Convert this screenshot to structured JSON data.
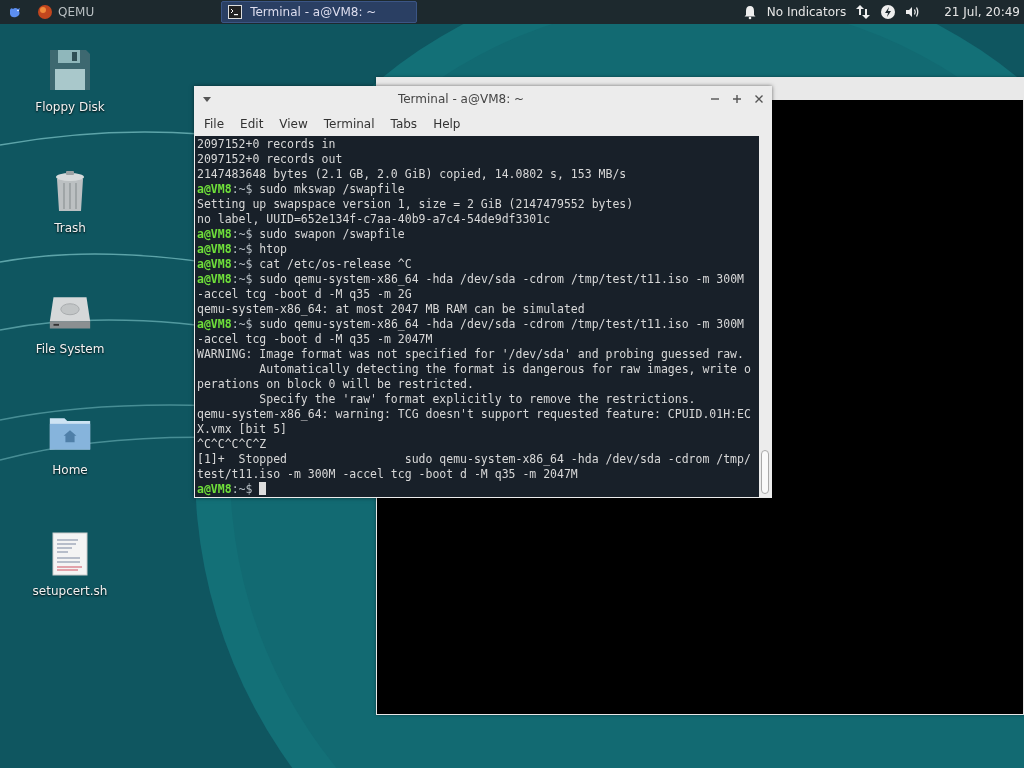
{
  "panel": {
    "app_menu": "QEMU",
    "tasks": [
      {
        "label": "Terminal - a@VM8: ~",
        "selected": true
      }
    ],
    "indicators": "No Indicators",
    "clock": "21 Jul, 20:49"
  },
  "desktop_icons": [
    {
      "kind": "floppy",
      "label": "Floppy Disk"
    },
    {
      "kind": "trash",
      "label": "Trash"
    },
    {
      "kind": "drive",
      "label": "File System"
    },
    {
      "kind": "home",
      "label": "Home"
    },
    {
      "kind": "script",
      "label": "setupcert.sh"
    }
  ],
  "terminal": {
    "title": "Terminal - a@VM8: ~",
    "menu": [
      "File",
      "Edit",
      "View",
      "Terminal",
      "Tabs",
      "Help"
    ],
    "lines": [
      {
        "kind": "output",
        "text": "2097152+0 records in"
      },
      {
        "kind": "output",
        "text": "2097152+0 records out"
      },
      {
        "kind": "output",
        "text": "2147483648 bytes (2.1 GB, 2.0 GiB) copied, 14.0802 s, 153 MB/s"
      },
      {
        "kind": "prompt",
        "user": "a@VM8",
        "suffix": ":~$",
        "command": " sudo mkswap /swapfile"
      },
      {
        "kind": "output",
        "text": "Setting up swapspace version 1, size = 2 GiB (2147479552 bytes)"
      },
      {
        "kind": "output",
        "text": "no label, UUID=652e134f-c7aa-40b9-a7c4-54de9df3301c"
      },
      {
        "kind": "prompt",
        "user": "a@VM8",
        "suffix": ":~$",
        "command": " sudo swapon /swapfile"
      },
      {
        "kind": "prompt",
        "user": "a@VM8",
        "suffix": ":~$",
        "command": " htop"
      },
      {
        "kind": "prompt",
        "user": "a@VM8",
        "suffix": ":~$",
        "command": " cat /etc/os-release ^C"
      },
      {
        "kind": "prompt",
        "user": "a@VM8",
        "suffix": ":~$",
        "command": " sudo qemu-system-x86_64 -hda /dev/sda -cdrom /tmp/test/t11.iso -m 300M"
      },
      {
        "kind": "output",
        "text": "-accel tcg -boot d -M q35 -m 2G"
      },
      {
        "kind": "output",
        "text": "qemu-system-x86_64: at most 2047 MB RAM can be simulated"
      },
      {
        "kind": "prompt",
        "user": "a@VM8",
        "suffix": ":~$",
        "command": " sudo qemu-system-x86_64 -hda /dev/sda -cdrom /tmp/test/t11.iso -m 300M"
      },
      {
        "kind": "output",
        "text": "-accel tcg -boot d -M q35 -m 2047M"
      },
      {
        "kind": "output",
        "text": "WARNING: Image format was not specified for '/dev/sda' and probing guessed raw."
      },
      {
        "kind": "output",
        "text": "         Automatically detecting the format is dangerous for raw images, write o"
      },
      {
        "kind": "output",
        "text": "perations on block 0 will be restricted."
      },
      {
        "kind": "output",
        "text": "         Specify the 'raw' format explicitly to remove the restrictions."
      },
      {
        "kind": "output",
        "text": "qemu-system-x86_64: warning: TCG doesn't support requested feature: CPUID.01H:EC"
      },
      {
        "kind": "output",
        "text": "X.vmx [bit 5]"
      },
      {
        "kind": "output",
        "text": "^C^C^C^C^Z"
      },
      {
        "kind": "output",
        "text": "[1]+  Stopped                 sudo qemu-system-x86_64 -hda /dev/sda -cdrom /tmp/"
      },
      {
        "kind": "output",
        "text": "test/t11.iso -m 300M -accel tcg -boot d -M q35 -m 2047M"
      },
      {
        "kind": "prompt",
        "user": "a@VM8",
        "suffix": ":~$",
        "cursor": true
      }
    ]
  }
}
